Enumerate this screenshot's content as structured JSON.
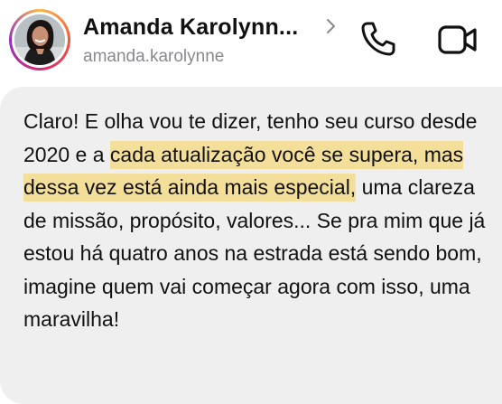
{
  "contact": {
    "display_name": "Amanda Karolynn...",
    "username": "amanda.karolynne"
  },
  "icons": {
    "chevron": "chevron-right-icon",
    "call": "phone-icon",
    "video": "video-camera-icon"
  },
  "colors": {
    "highlight": "#f3df9a",
    "bubble": "#efefef",
    "text": "#111111",
    "muted": "#8a8a8e"
  },
  "message": {
    "part_1": "Claro! E olha vou te dizer, tenho seu curso desde 2020 e a ",
    "highlight": "cada atualização você se supera, mas dessa vez está ainda mais especial,",
    "part_2": " uma clareza de missão, propósito, valores... Se pra mim que já estou há quatro anos na estrada está sendo bom, imagine quem vai começar agora com isso, uma maravilha!"
  }
}
